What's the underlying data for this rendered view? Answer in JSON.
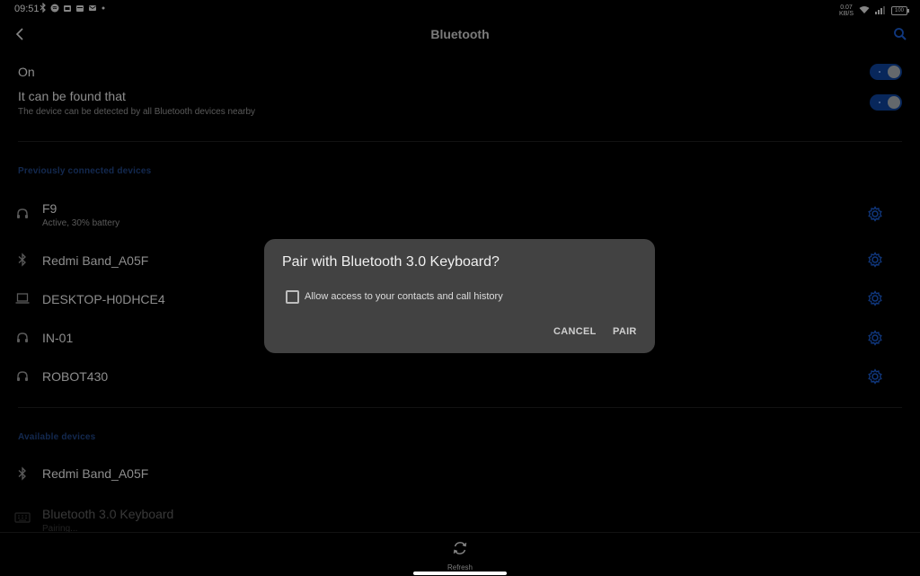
{
  "status_bar": {
    "time": "09:51",
    "speed_top": "0.07",
    "speed_bottom": "KB/S",
    "battery": "100"
  },
  "header": {
    "title": "Bluetooth"
  },
  "settings": {
    "on": {
      "label": "On",
      "enabled": true
    },
    "discoverable": {
      "label": "It can be found that",
      "description": "The device can be detected by all Bluetooth devices nearby",
      "enabled": true
    }
  },
  "previously_connected": {
    "header": "Previously connected devices",
    "devices": [
      {
        "name": "F9",
        "status": "Active, 30% battery",
        "icon": "headphones-icon"
      },
      {
        "name": "Redmi Band_A05F",
        "icon": "bluetooth-icon"
      },
      {
        "name": "DESKTOP-H0DHCE4",
        "icon": "laptop-icon"
      },
      {
        "name": "IN-01",
        "icon": "headphones-icon"
      },
      {
        "name": "ROBOT430",
        "icon": "headphones-icon"
      }
    ]
  },
  "available": {
    "header": "Available devices",
    "devices": [
      {
        "name": "Redmi Band_A05F",
        "icon": "bluetooth-icon"
      },
      {
        "name": "Bluetooth 3.0 Keyboard",
        "status": "Pairing...",
        "icon": "keyboard-icon"
      }
    ]
  },
  "bottom_bar": {
    "refresh_label": "Refresh"
  },
  "dialog": {
    "title": "Pair with Bluetooth 3.0 Keyboard?",
    "checkbox_label": "Allow access to your contacts and call history",
    "checkbox_checked": false,
    "cancel_label": "CANCEL",
    "pair_label": "PAIR"
  },
  "colors": {
    "accent": "#1a56c4",
    "toggle_track": "#0d3d8c",
    "section_header": "#1e3f7a",
    "dialog_background": "#424242"
  }
}
